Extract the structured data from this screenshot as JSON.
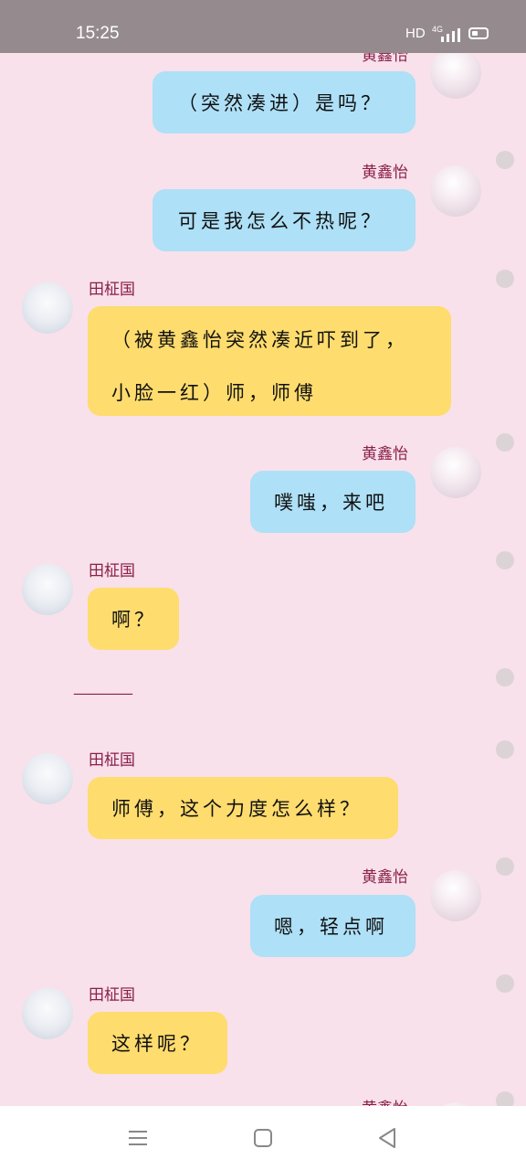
{
  "status_bar": {
    "time": "15:25",
    "hd": "HD",
    "network": "4G"
  },
  "chat": {
    "items": [
      {
        "sender": "黄鑫怡",
        "text": "（突然凑进）是吗？"
      },
      {
        "sender": "黄鑫怡",
        "text": "可是我怎么不热呢？"
      },
      {
        "sender": "田柾国",
        "text": "（被黄鑫怡突然凑近吓到了，小脸一红）师，师傅"
      },
      {
        "sender": "黄鑫怡",
        "text": "噗嗤，来吧"
      },
      {
        "sender": "田柾国",
        "text": "啊？"
      },
      {
        "divider": "————"
      },
      {
        "sender": "田柾国",
        "text": "师傅，这个力度怎么样？"
      },
      {
        "sender": "黄鑫怡",
        "text": "嗯，轻点啊"
      },
      {
        "sender": "田柾国",
        "text": "这样呢？"
      },
      {
        "sender": "黄鑫怡"
      }
    ]
  },
  "colors": {
    "background": "#f8e1ea",
    "bubble_right": "#aee0f7",
    "bubble_left": "#fedc6e",
    "name": "#8a1f4a",
    "status_bar": "#958b8f"
  },
  "nav_bar": {
    "icons": [
      "menu-icon",
      "home-icon",
      "back-icon"
    ]
  }
}
